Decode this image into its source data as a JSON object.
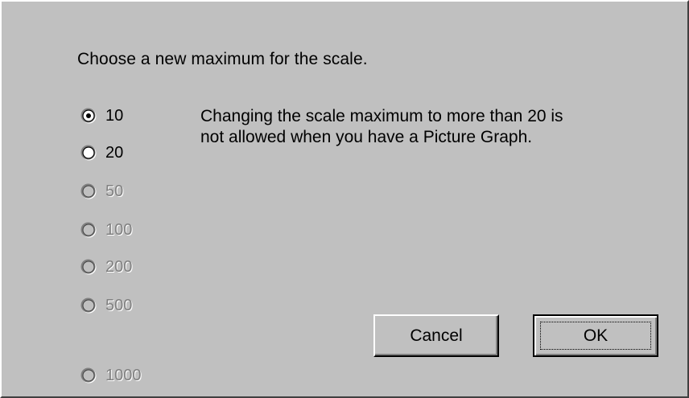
{
  "dialog": {
    "prompt": "Choose a new maximum for the scale.",
    "message_line1": "Changing the scale maximum to more than 20 is",
    "message_line2": "not allowed when you have a Picture Graph."
  },
  "scale_options": [
    {
      "label": "10",
      "selected": true,
      "enabled": true
    },
    {
      "label": "20",
      "selected": false,
      "enabled": true
    },
    {
      "label": "50",
      "selected": false,
      "enabled": false
    },
    {
      "label": "100",
      "selected": false,
      "enabled": false
    },
    {
      "label": "200",
      "selected": false,
      "enabled": false
    },
    {
      "label": "500",
      "selected": false,
      "enabled": false
    },
    {
      "label": "1000",
      "selected": false,
      "enabled": false
    }
  ],
  "buttons": {
    "cancel_label": "Cancel",
    "ok_label": "OK"
  },
  "colors": {
    "face": "#c0c0c0",
    "highlight": "#ffffff",
    "shadow": "#808080",
    "dark_shadow": "#404040",
    "disabled_text": "#808080"
  }
}
